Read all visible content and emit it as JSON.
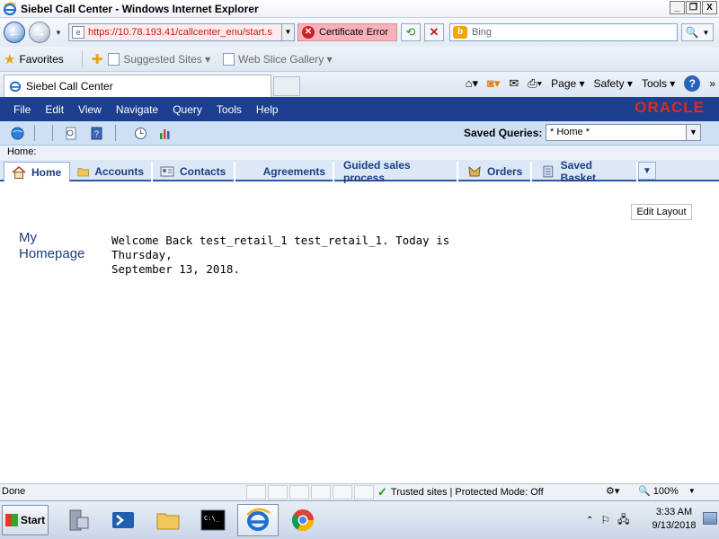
{
  "window": {
    "title": "Siebel Call Center - Windows Internet Explorer",
    "minimize": "_",
    "maximize": "❐",
    "close": "X"
  },
  "address": {
    "url": "https://10.78.193.41/callcenter_enu/start.s",
    "cert_error": "Certificate Error",
    "search_placeholder": "Bing"
  },
  "favorites": {
    "label": "Favorites",
    "items": [
      "Suggested Sites ▾",
      "Web Slice Gallery ▾"
    ]
  },
  "tab": {
    "title": "Siebel Call Center"
  },
  "command_bar": {
    "page": "Page ▾",
    "safety": "Safety ▾",
    "tools": "Tools ▾",
    "more": "»"
  },
  "siebel": {
    "menu": [
      "File",
      "Edit",
      "View",
      "Navigate",
      "Query",
      "Tools",
      "Help"
    ],
    "brand": "ORACLE",
    "saved_queries_label": "Saved Queries:",
    "saved_queries_value": "* Home *",
    "breadcrumb": "Home:",
    "screen_tabs": [
      "Home",
      "Accounts",
      "Contacts",
      "Agreements",
      "Guided sales process",
      "Orders",
      "Saved Basket"
    ],
    "edit_layout": "Edit Layout",
    "homepage_title": "My Homepage",
    "welcome_line1": "Welcome Back test_retail_1 test_retail_1.  Today is Thursday,",
    "welcome_line2": "September 13, 2018."
  },
  "status": {
    "done": "Done",
    "trusted": "Trusted sites | Protected Mode: Off",
    "zoom": "100%"
  },
  "taskbar": {
    "start": "Start",
    "time": "3:33 AM",
    "date": "9/13/2018"
  }
}
